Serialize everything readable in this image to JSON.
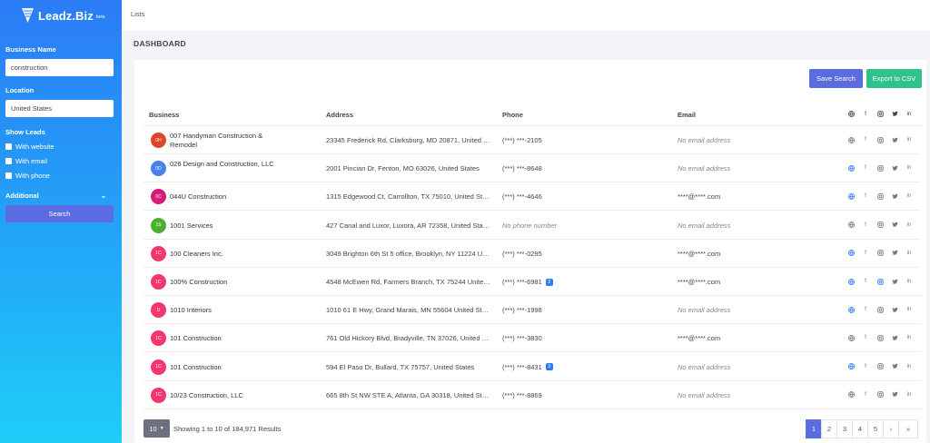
{
  "app": {
    "name": "Leadz.Biz",
    "badge": "beta"
  },
  "sidebar": {
    "business_name_label": "Business Name",
    "business_name_value": "construction",
    "location_label": "Location",
    "location_value": "United States",
    "show_leads_label": "Show Leads",
    "filters": [
      "With website",
      "With email",
      "With phone"
    ],
    "additional_label": "Additional",
    "search_label": "Search"
  },
  "header": {
    "breadcrumb": "Lists",
    "section_title": "DASHBOARD"
  },
  "actions": {
    "save_search": "Save Search",
    "export_csv": "Export to CSV"
  },
  "table": {
    "columns": [
      "Business",
      "Address",
      "Phone",
      "Email"
    ],
    "header_icons": [
      "globe-icon",
      "facebook-icon",
      "instagram-icon",
      "twitter-icon",
      "linkedin-icon"
    ],
    "rows": [
      {
        "initials": "0H",
        "color": "#e0452b",
        "name": "007 Handyman Construction & Remodel",
        "address": "23345 Frederick Rd, Clarksburg, MD 20871, United States",
        "phone": "(***) ***-2105",
        "phone_badge": "",
        "email": "No email address",
        "email_present": false,
        "social": [
          false,
          false,
          false,
          false,
          false
        ]
      },
      {
        "initials": "0D",
        "color": "#4a7ff0",
        "name": "026 Design and Construction, LLC",
        "address": "2001 Pincian Dr, Fenton, MO 63026, United States",
        "phone": "(***) ***-8648",
        "phone_badge": "",
        "email": "No email address",
        "email_present": false,
        "social": [
          true,
          false,
          false,
          false,
          false
        ]
      },
      {
        "initials": "0C",
        "color": "#d81b7b",
        "name": "044U Construction",
        "address": "1315 Edgewood Ct, Carrollton, TX 75010, United States",
        "phone": "(***) ***-4646",
        "phone_badge": "",
        "email": "****@****.com",
        "email_present": true,
        "social": [
          true,
          false,
          false,
          false,
          false
        ]
      },
      {
        "initials": "1S",
        "color": "#4caf2f",
        "name": "1001 Services",
        "address": "427 Canal and Luxor, Luxora, AR 72358, United States",
        "phone": "No phone number",
        "phone_badge": "",
        "email": "No email address",
        "email_present": false,
        "social": [
          false,
          false,
          false,
          false,
          false
        ]
      },
      {
        "initials": "1C",
        "color": "#f2376f",
        "name": "100 Cleaners Inc.",
        "address": "3049 Brighton 6th St 5 office, Brooklyn, NY 11224 United States",
        "phone": "(***) ***-0295",
        "phone_badge": "",
        "email": "****@****.com",
        "email_present": true,
        "social": [
          true,
          false,
          false,
          false,
          false
        ]
      },
      {
        "initials": "1C",
        "color": "#f2376f",
        "name": "100% Construction",
        "address": "4548 McEwen Rd, Farmers Branch, TX 75244 United States",
        "phone": "(***) ***-6981",
        "phone_badge": "2",
        "email": "****@****.com",
        "email_present": true,
        "social": [
          true,
          true,
          true,
          false,
          false
        ]
      },
      {
        "initials": "1I",
        "color": "#f2376f",
        "name": "1010 Interiors",
        "address": "1010 61 E Hwy, Grand Marais, MN 55604 United States",
        "phone": "(***) ***-1998",
        "phone_badge": "",
        "email": "No email address",
        "email_present": false,
        "social": [
          true,
          false,
          false,
          false,
          false
        ]
      },
      {
        "initials": "1C",
        "color": "#f2376f",
        "name": "101 Construction",
        "address": "761 Old Hickory Blvd, Bradyville, TN 37026, United States",
        "phone": "(***) ***-3830",
        "phone_badge": "",
        "email": "****@****.com",
        "email_present": true,
        "social": [
          false,
          false,
          false,
          false,
          false
        ]
      },
      {
        "initials": "1C",
        "color": "#f2376f",
        "name": "101 Construction",
        "address": "594 El Paso Dr, Bullard, TX 75757, United States",
        "phone": "(***) ***-8431",
        "phone_badge": "3",
        "email": "No email address",
        "email_present": false,
        "social": [
          true,
          true,
          false,
          false,
          false
        ]
      },
      {
        "initials": "1C",
        "color": "#f2376f",
        "name": "10/23 Construction, LLC",
        "address": "665 8th St NW STE A, Atlanta, GA 30318, United States",
        "phone": "(***) ***-8869",
        "phone_badge": "",
        "email": "No email address",
        "email_present": false,
        "social": [
          false,
          false,
          false,
          false,
          false
        ]
      }
    ]
  },
  "footer": {
    "per_page": "10",
    "results_text": "Showing 1 to 10 of 184,971 Results",
    "pages": [
      "1",
      "2",
      "3",
      "4",
      "5"
    ],
    "active_page": "1",
    "next": "›",
    "last": "»"
  }
}
